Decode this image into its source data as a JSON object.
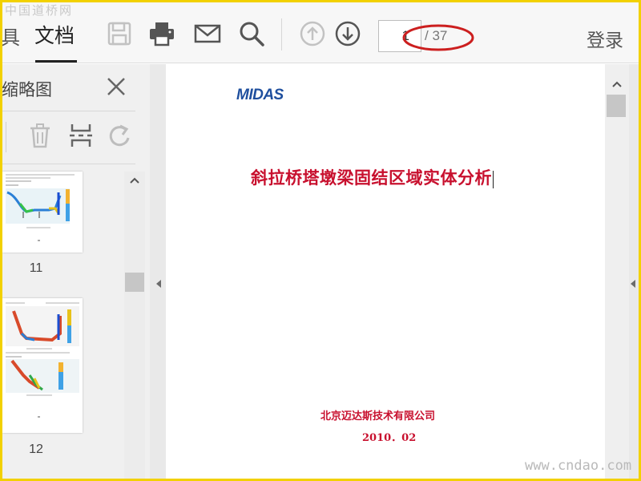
{
  "watermark": {
    "top": "中国道桥网",
    "bottom": "www.cndao.com"
  },
  "toolbar": {
    "tab_left_partial": "具",
    "tab_active": "文档",
    "icons": [
      "save-icon",
      "print-icon",
      "mail-icon",
      "search-icon",
      "arrow-up-icon",
      "arrow-down-icon"
    ],
    "page_current": "1",
    "page_total": "/ 37",
    "login": "登录"
  },
  "sidebar": {
    "title": "缩略图",
    "tools": [
      "trash-icon",
      "split-icon",
      "rotate-icon"
    ],
    "thumbnails": [
      {
        "page": "11"
      },
      {
        "page": "12"
      }
    ]
  },
  "document": {
    "logo": "MIDAS",
    "title": "斜拉桥塔墩梁固结区域实体分析",
    "company": "北京迈达斯技术有限公司",
    "date": "2010．02"
  },
  "colors": {
    "frame": "#f2d100",
    "title_red": "#c8102e",
    "logo_blue": "#1f4f9e",
    "annotation_red": "#cc1f1f"
  }
}
